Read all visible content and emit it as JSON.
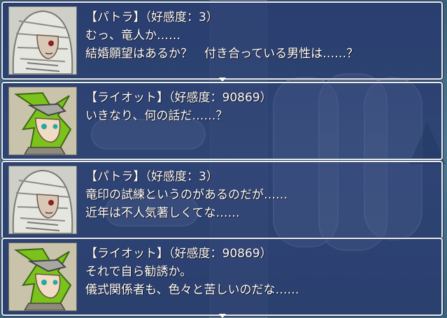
{
  "messages": [
    {
      "speaker_tag": "【パトラ】（好感度：3）",
      "lines": [
        "むっ、竜人か……",
        "結婚願望はあるか？　付き合っている男性は……？"
      ],
      "face": "patra-face",
      "show_cursor": true
    },
    {
      "speaker_tag": "【ライオット】（好感度：90869）",
      "lines": [
        "いきなり、何の話だ……？"
      ],
      "face": "raiot-face",
      "show_cursor": false
    },
    {
      "speaker_tag": "【パトラ】（好感度：3）",
      "lines": [
        "竜印の試練というのがあるのだが……",
        "近年は不人気著しくてな……"
      ],
      "face": "patra-face",
      "show_cursor": false
    },
    {
      "speaker_tag": "【ライオット】（好感度：90869）",
      "lines": [
        "それで自ら勧誘か。",
        "儀式関係者も、色々と苦しいのだな……"
      ],
      "face": "raiot-face",
      "show_cursor": true
    }
  ],
  "colors": {
    "window_bg": "#26366e",
    "window_border": "#e9eef6",
    "text": "#ffffff"
  }
}
